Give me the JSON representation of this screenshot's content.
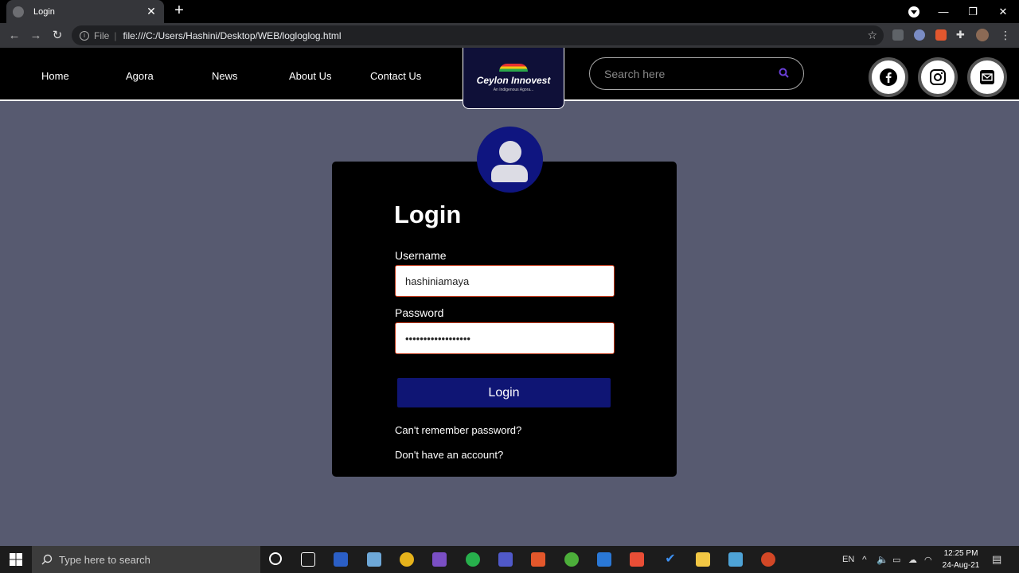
{
  "browser": {
    "tab_title": "Login",
    "url_scheme": "File",
    "url": "file:///C:/Users/Hashini/Desktop/WEB/logloglog.html"
  },
  "site": {
    "nav": [
      "Home",
      "Agora",
      "News",
      "About Us",
      "Contact Us"
    ],
    "logo_title": "Ceylon Innovest",
    "logo_tagline": "An Indigenous Agora...",
    "search_placeholder": "Search here",
    "social": [
      "facebook-icon",
      "instagram-icon",
      "mail-icon"
    ]
  },
  "login": {
    "title": "Login",
    "username_label": "Username",
    "username_value": "hashiniamaya",
    "password_label": "Password",
    "password_value": "••••••••••••••••••",
    "button_label": "Login",
    "forgot_link": "Can't remember password?",
    "signup_link": "Don't have an account?"
  },
  "taskbar": {
    "search_placeholder": "Type here to search",
    "lang": "EN",
    "time": "12:25 PM",
    "date": "24-Aug-21"
  },
  "colors": {
    "page_bg": "#575a70",
    "accent": "#0f1574",
    "input_border": "#c0391b"
  }
}
